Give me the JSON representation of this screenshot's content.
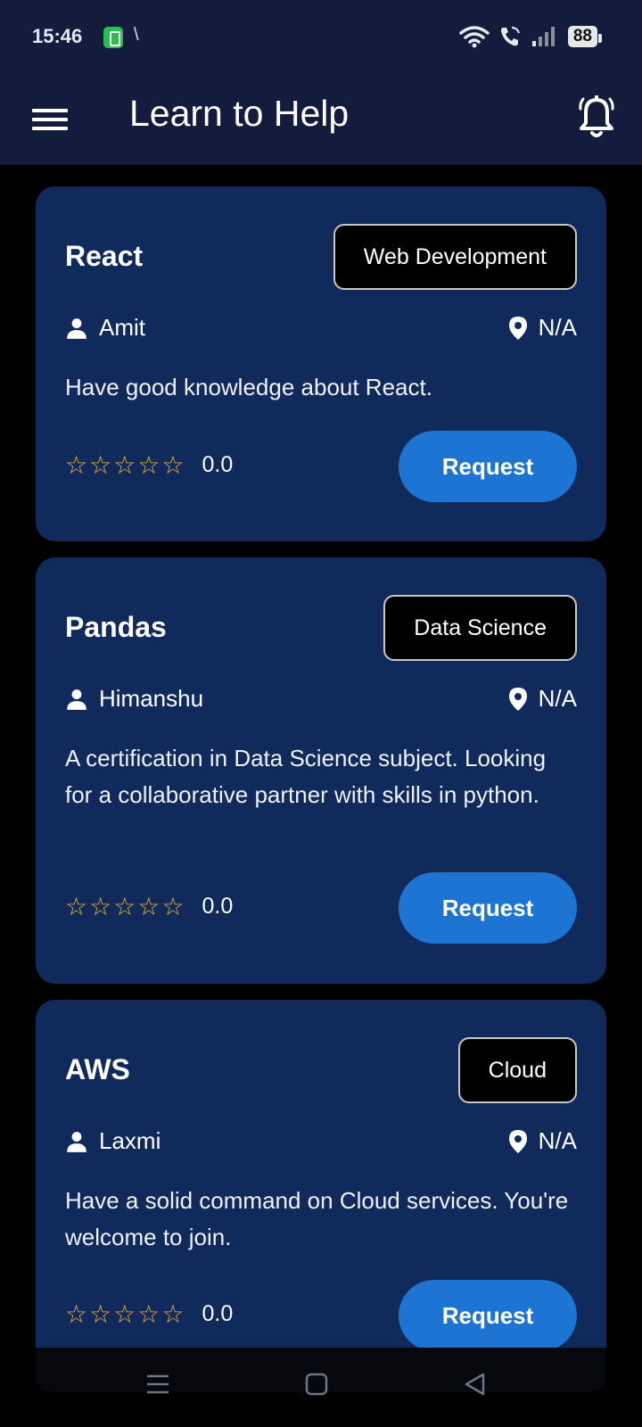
{
  "status_bar": {
    "time": "15:46",
    "battery": "88"
  },
  "app_bar": {
    "title": "Learn to Help"
  },
  "cards": [
    {
      "title": "React",
      "category": "Web Development",
      "author": "Amit",
      "location": "N/A",
      "description": "Have good knowledge about React.",
      "stars": "☆☆☆☆☆",
      "rating": "0.0",
      "action": "Request"
    },
    {
      "title": "Pandas",
      "category": "Data Science",
      "author": "Himanshu",
      "location": "N/A",
      "description": "A certification in Data Science subject. Looking for a collaborative partner with skills in python.",
      "stars": "☆☆☆☆☆",
      "rating": "0.0",
      "action": "Request"
    },
    {
      "title": "AWS",
      "category": "Cloud",
      "author": "Laxmi",
      "location": "N/A",
      "description": "Have a solid command on Cloud services. You're welcome to join.",
      "stars": "☆☆☆☆☆",
      "rating": "0.0",
      "action": "Request"
    }
  ],
  "icons": {
    "menu": "hamburger-menu-icon",
    "bell": "notification-bell-icon",
    "author": "person-icon",
    "location": "location-pin-icon"
  },
  "colors": {
    "app_bar": "#131c3d",
    "card": "#102a5c",
    "button": "#1e74d3",
    "star": "#f2b230"
  }
}
